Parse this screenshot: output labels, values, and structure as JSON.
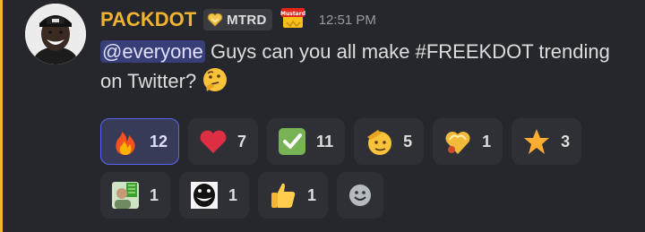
{
  "message": {
    "username": "PACKDOT",
    "role_tag": "MTRD",
    "timestamp": "12:51 PM",
    "mention": "@everyone",
    "text": " Guys can you all make #FREEKDOT trending on Twitter? "
  },
  "reactions": [
    {
      "emoji": "fire-emoji",
      "count": "12",
      "active": true
    },
    {
      "emoji": "red-heart-emoji",
      "count": "7",
      "active": false
    },
    {
      "emoji": "check-mark-emoji",
      "count": "11",
      "active": false
    },
    {
      "emoji": "saluting-face-emoji",
      "count": "5",
      "active": false
    },
    {
      "emoji": "custom-gold-heart-emoji",
      "count": "1",
      "active": false
    },
    {
      "emoji": "star-emoji",
      "count": "3",
      "active": false
    },
    {
      "emoji": "custom-person-money-emoji",
      "count": "1",
      "active": false
    },
    {
      "emoji": "custom-smile-face-emoji",
      "count": "1",
      "active": false
    },
    {
      "emoji": "thumbs-up-emoji",
      "count": "1",
      "active": false
    }
  ],
  "colors": {
    "username": "#f0b232",
    "mention_bg": "#5865f2",
    "background": "#26272c"
  }
}
